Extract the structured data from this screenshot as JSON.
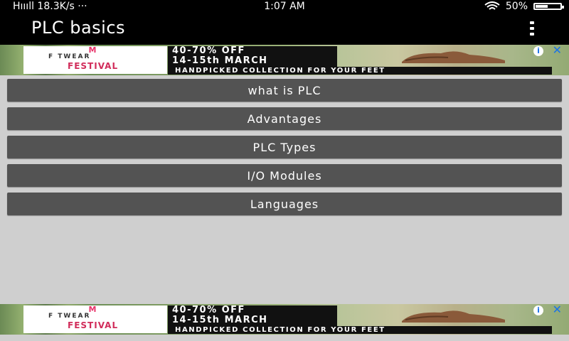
{
  "status_bar": {
    "signal_speed": "Hıııll 18.3K/s ···",
    "time": "1:07 AM",
    "wifi_icon": "wifi-icon",
    "battery_percent": "50%",
    "battery_level": 0.5
  },
  "app_bar": {
    "title": "PLC basics",
    "overflow_icon": "overflow-menu-icon"
  },
  "ad": {
    "brand_line1": "F  TWEAR",
    "brand_line2": "FESTIVAL",
    "headline1": "40-70% OFF",
    "headline2": "14-15th MARCH",
    "tagline": "HANDPICKED COLLECTION FOR YOUR FEET",
    "info_label": "i",
    "close_label": "✕"
  },
  "menu": {
    "items": [
      {
        "label": "what is PLC"
      },
      {
        "label": "Advantages"
      },
      {
        "label": "PLC Types"
      },
      {
        "label": "I/O Modules"
      },
      {
        "label": "Languages"
      }
    ]
  },
  "colors": {
    "background": "#cfcfcf",
    "app_bar": "#000000",
    "button": "#535353",
    "button_text": "#ffffff"
  }
}
